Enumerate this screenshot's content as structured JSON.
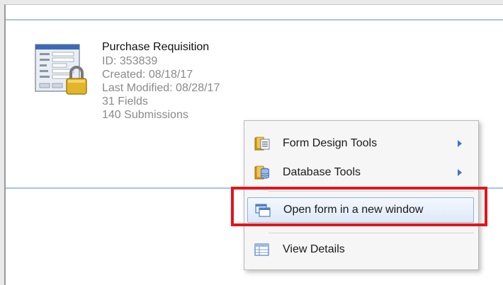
{
  "form": {
    "title": "Purchase Requisition",
    "id": "ID: 353839",
    "created": "Created: 08/18/17",
    "modified": "Last Modified: 08/28/17",
    "fields": "31 Fields",
    "submissions": "140 Submissions",
    "thumbnail_icon": "form-lock-icon"
  },
  "context_menu": {
    "items": [
      {
        "label": "Form Design Tools",
        "icon": "book-form-icon",
        "has_submenu": true
      },
      {
        "label": "Database Tools",
        "icon": "book-database-icon",
        "has_submenu": true
      },
      {
        "label": "Open form in a new window",
        "icon": "new-window-icon",
        "has_submenu": false,
        "highlighted": true
      },
      {
        "label": "View Details",
        "icon": "table-details-icon",
        "has_submenu": false
      }
    ]
  },
  "colors": {
    "highlight_border": "#8eb1dc",
    "annotation": "#e0161d",
    "rule": "#a8c3e4"
  }
}
